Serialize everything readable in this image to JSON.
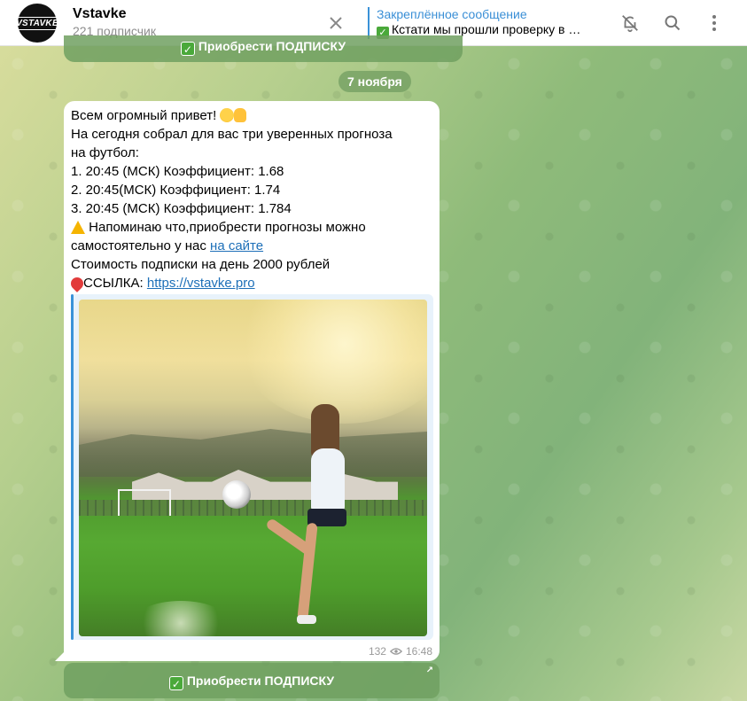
{
  "header": {
    "channel_name": "Vstavke",
    "subscribers": "221 подписчик",
    "avatar_text": "VSTAVKE",
    "pinned_title": "Закреплённое сообщение",
    "pinned_text": "Кстати мы прошли проверку в …"
  },
  "chat": {
    "top_button_label": "Приобрести ПОДПИСКУ",
    "date_badge": "7 ноября",
    "message": {
      "line1": "Всем огромный привет!",
      "line2": "На сегодня собрал для вас три уверенных прогноза",
      "line3": "на футбол:",
      "line4": "1. 20:45 (МСК) Коэффициент:  1.68",
      "line5": "2. 20:45(МСК)  Коэффициент: 1.74",
      "line6": "3. 20:45 (МСК)  Коэффициент: 1.784",
      "line7": "Напоминаю что,приобрести прогнозы можно",
      "line8_prefix": "самостоятельно у нас ",
      "line8_link": "на сайте",
      "line9": "Стоимость подписки на день 2000 рублей",
      "line10_prefix": "ССЫЛКА: ",
      "line10_link": "https://vstavke.pro"
    },
    "views": "132",
    "time": "16:48",
    "button_label": "Приобрести ПОДПИСКУ"
  },
  "icons": {
    "close": "close-icon",
    "mute": "bell-off-icon",
    "search": "search-icon",
    "more": "more-vertical-icon",
    "views": "eye-icon",
    "external": "arrow-up-right-icon"
  },
  "colors": {
    "accent": "#3a92d8",
    "link": "#1d6fb8",
    "check": "#4aa93a",
    "button_bg": "#70a060"
  }
}
